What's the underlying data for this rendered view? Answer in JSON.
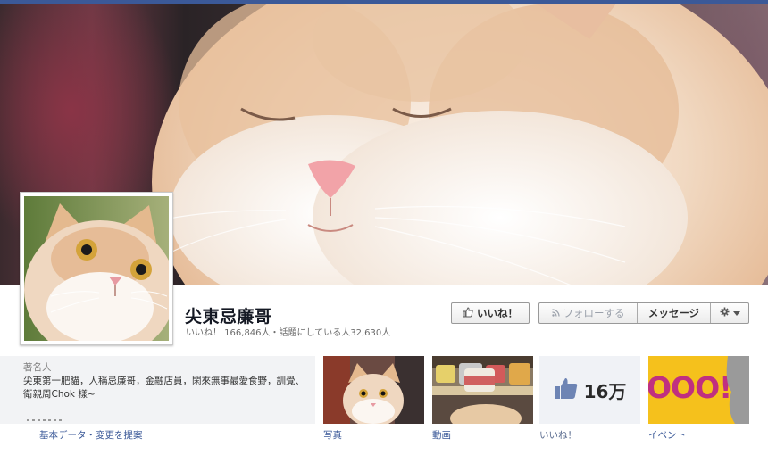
{
  "page": {
    "name": "尖東忌廉哥",
    "stats": "いいね！ 166,846人・話題にしている人32,630人"
  },
  "actions": {
    "like_label": "いいね！",
    "follow_label": "フォローする",
    "message_label": "メッセージ"
  },
  "about": {
    "heading": "著名人",
    "text": "尖東第一肥貓，人稱忌廉哥，金融店員，閑來無事最愛食野，訓覺、衛親周Chok 樣~",
    "link_label": "基本データ・変更を提案"
  },
  "apps": [
    {
      "label": "写真",
      "icon": "photo-thumbnail"
    },
    {
      "label": "動画",
      "icon": "video-thumbnail"
    },
    {
      "label": "いいね！",
      "count": "16万",
      "icon": "thumbs-up-icon"
    },
    {
      "label": "イベント",
      "banner": "OOO!!"
    }
  ],
  "colors": {
    "brand_blue": "#3b5998",
    "link_blue": "#3b5998",
    "events_yellow": "#f5c11c",
    "events_text": "#c03080"
  }
}
